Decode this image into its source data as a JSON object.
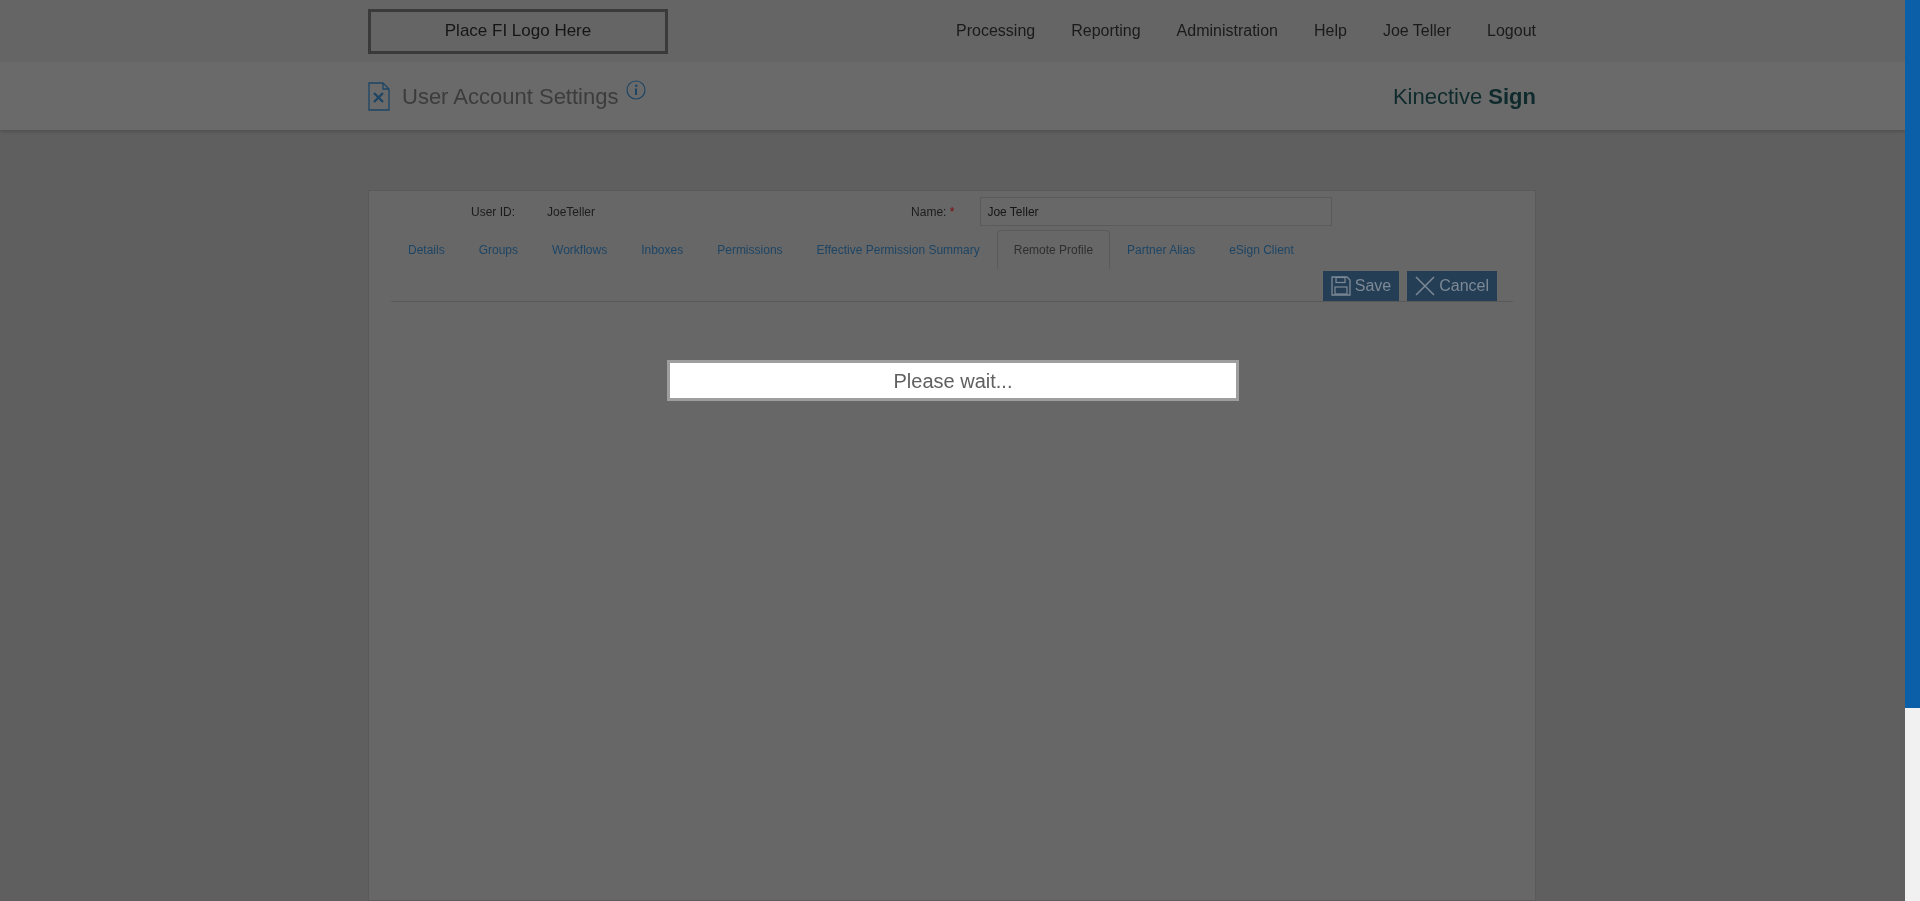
{
  "header": {
    "logo": "Place FI Logo Here",
    "nav": [
      "Processing",
      "Reporting",
      "Administration",
      "Help",
      "Joe Teller",
      "Logout"
    ]
  },
  "page_header": {
    "title": "User Account Settings",
    "brand": "Kinective **Sign**"
  },
  "form": {
    "user_id_label": "User ID:",
    "user_id": "JoeTeller",
    "name_label": "Name:",
    "name_required_mark": "*",
    "name_value": "Joe Teller"
  },
  "tabs": [
    {
      "label": "Details",
      "selected": false
    },
    {
      "label": "Groups",
      "selected": false
    },
    {
      "label": "Workflows",
      "selected": false
    },
    {
      "label": "Inboxes",
      "selected": false
    },
    {
      "label": "Permissions",
      "selected": false
    },
    {
      "label": "Effective Permission Summary",
      "selected": false
    },
    {
      "label": "Remote Profile",
      "selected": true
    },
    {
      "label": "Partner Alias",
      "selected": false
    },
    {
      "label": "eSign Client",
      "selected": false
    }
  ],
  "buttons": [
    {
      "kind": "save",
      "label": "Save"
    },
    {
      "kind": "cancel",
      "label": "Cancel"
    }
  ],
  "modal": {
    "message": "Please wait..."
  }
}
